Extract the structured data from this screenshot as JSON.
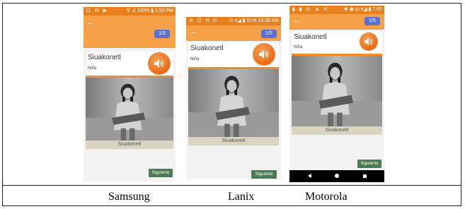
{
  "phones": [
    {
      "device": "Samsung",
      "status_left": "⊡ ✉ ▶",
      "status_right": "⚲ .ıl 100% ▮ 1:50 PM",
      "pager": "1/5",
      "word": "Siuakonetl",
      "subtitle": "Niña",
      "caption": "Siuakonetl",
      "next": "Siguiente"
    },
    {
      "device": "Lanix",
      "status_left": "⊘ ⊡ N ◘",
      "status_right": "⊙ ▾◢ ▮ 91% 10:38 AM",
      "pager": "1/5",
      "word": "Siuakonetl",
      "subtitle": "Niña",
      "caption": "Siuakonetl",
      "next": "Siguiente"
    },
    {
      "device": "Motorola",
      "status_left": "▮ ▮ ◎ ▲ N",
      "status_right": "✱ ◉ ◎ ▾◢ ▮ 7:00",
      "pager": "1/5",
      "word": "Siuakonetl",
      "subtitle": "Niña",
      "caption": "Siuakonetl",
      "next": "Siguiente"
    }
  ],
  "icons": {
    "back": "arrow-left-icon",
    "sound": "speaker-icon"
  },
  "colors": {
    "appbar": "#f5a046",
    "statusbar": "#e8801f",
    "pager": "#5b6fd0",
    "accent_bar": "#f58a28",
    "next_button": "#4c7a52",
    "caption_bg": "#d9d4c1"
  }
}
